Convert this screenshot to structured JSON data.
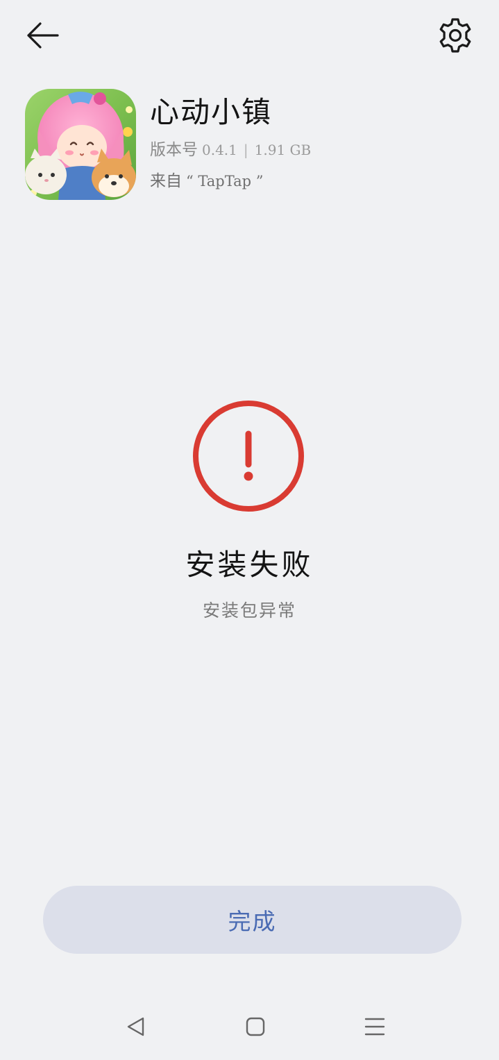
{
  "header": {
    "back_icon": "arrow-left-icon",
    "settings_icon": "gear-icon"
  },
  "app": {
    "name": "心动小镇",
    "version_label": "版本号",
    "version": "0.4.1",
    "separator": "|",
    "size": "1.91 GB",
    "source_prefix": "来自",
    "source": "“ TapTap ”"
  },
  "status": {
    "icon": "error-exclamation-icon",
    "title": "安装失败",
    "subtitle": "安装包异常"
  },
  "actions": {
    "done_label": "完成"
  },
  "nav_bar": {
    "back_icon": "nav-back-icon",
    "home_icon": "nav-home-icon",
    "menu_icon": "nav-menu-icon"
  },
  "colors": {
    "background": "#f0f1f3",
    "error_red": "#d93b32",
    "button_bg": "#dcdfea",
    "button_text": "#4a6bb3"
  }
}
